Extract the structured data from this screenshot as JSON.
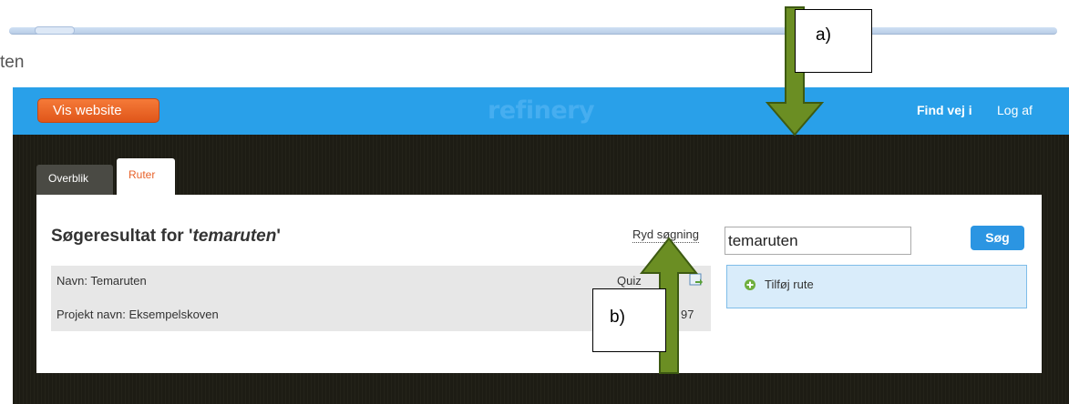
{
  "browser": {
    "partial_text": "ten"
  },
  "header": {
    "vis_website_label": "Vis website",
    "logo_text": "refinery",
    "find_label": "Find vej i",
    "logout_label": "Log af"
  },
  "tabs": [
    {
      "label": "Overblik"
    },
    {
      "label": "Ruter"
    }
  ],
  "main": {
    "title_prefix": "Søgeresultat for '",
    "title_query": "temaruten",
    "title_suffix": "'",
    "clear_search_label": "Ryd søgning"
  },
  "search": {
    "value": "temaruten",
    "button_label": "Søg"
  },
  "results": [
    {
      "name": "Navn: Temaruten",
      "project": "Projekt navn: Eksempelskoven",
      "quiz_label": "Quiz",
      "number": "97"
    }
  ],
  "actions": {
    "add_route_label": "Tilføj rute"
  },
  "annotations": {
    "a": "a)",
    "b": "b)"
  },
  "colors": {
    "header_bg": "#29a0e9",
    "accent_orange": "#e8622a",
    "arrow_green": "#6b8e23",
    "button_blue": "#2b95e2"
  }
}
